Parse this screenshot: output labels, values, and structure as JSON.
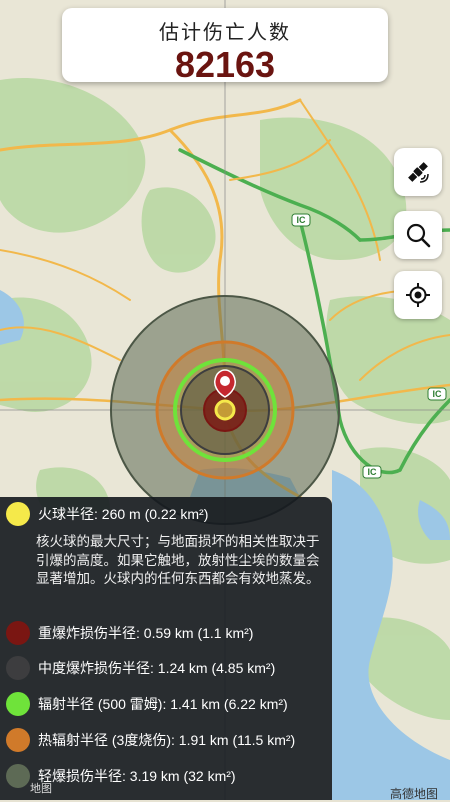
{
  "header": {
    "title": "估计伤亡人数",
    "casualties": "82163"
  },
  "controls": [
    {
      "name": "satellite-layer-button",
      "icon": "satellite-icon"
    },
    {
      "name": "search-button",
      "icon": "search-icon"
    },
    {
      "name": "locate-button",
      "icon": "crosshair-locate-icon"
    }
  ],
  "map": {
    "road_badge": "IC",
    "attribution": "高德地图",
    "attribution_left": "地图"
  },
  "legend": {
    "fireball": {
      "label": "火球半径: 260 m (0.22 km²)",
      "color": "#f5e94a"
    },
    "fireball_desc": "核火球的最大尺寸；与地面损坏的相关性取决于引爆的高度。如果它触地，放射性尘埃的数量会显著增加。火球内的任何东西都会有效地蒸发。",
    "heavy_blast": {
      "label": "重爆炸损伤半径: 0.59 km (1.1 km²)",
      "color": "#7a1612"
    },
    "moderate_blast": {
      "label": "中度爆炸损伤半径: 1.24 km (4.85 km²)",
      "color": "#3d3d3f"
    },
    "radiation": {
      "label": "辐射半径 (500 雷姆): 1.41 km (6.22 km²)",
      "color": "#6fe33a"
    },
    "thermal": {
      "label": "热辐射半径 (3度烧伤): 1.91 km (11.5 km²)",
      "color": "#d07a2a"
    },
    "light_blast": {
      "label": "轻爆损伤半径: 3.19 km (32 km²)",
      "color": "#5d6a55"
    }
  }
}
